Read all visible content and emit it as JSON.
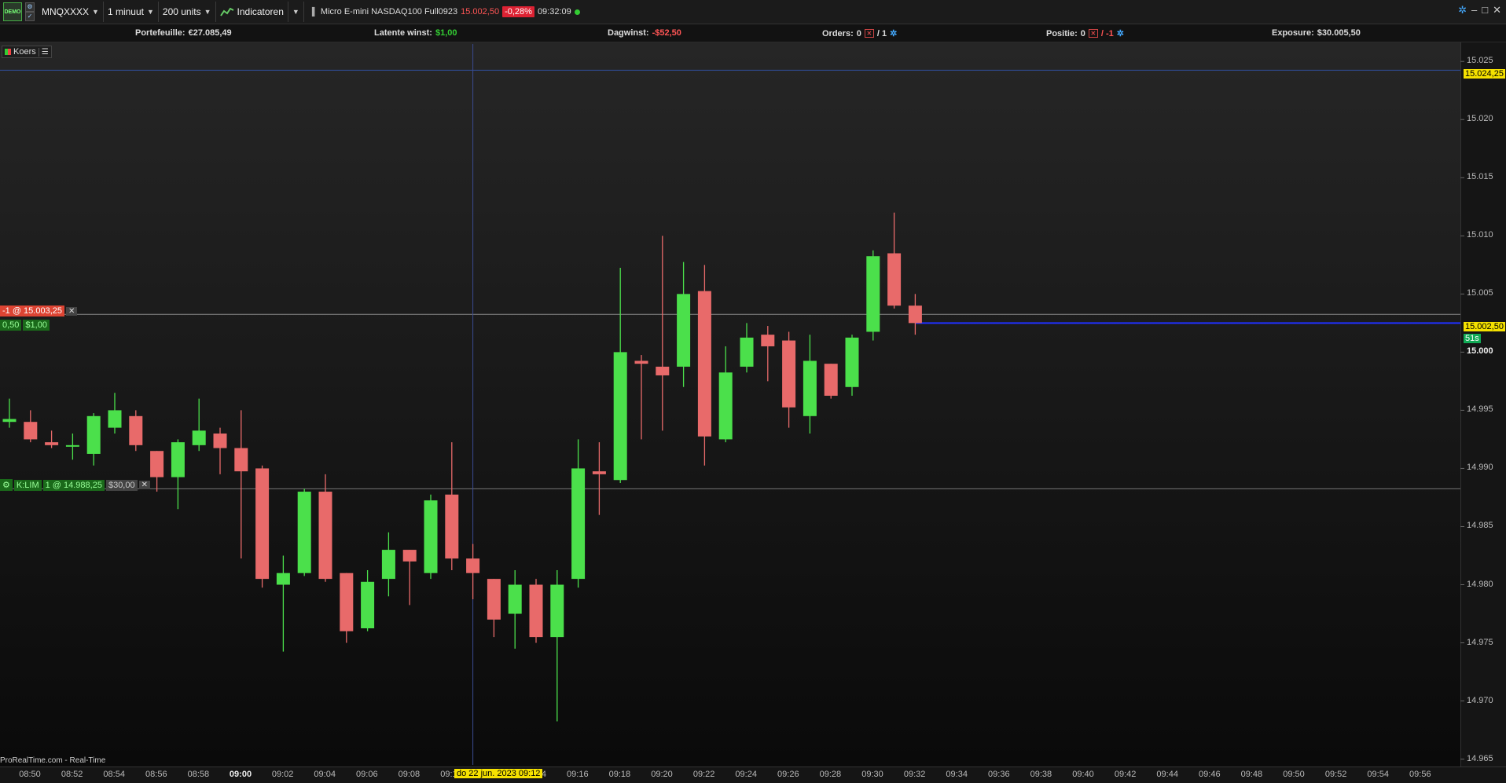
{
  "toolbar": {
    "logo": "DEMO",
    "symbol": "MNQXXXX",
    "timeframe": "1 minuut",
    "units": "200 units",
    "indicators": "Indicatoren",
    "instrument": "Micro E-mini NASDAQ100 Full0923",
    "last_price": "15.002,50",
    "change_pct": "-0,28%",
    "time": "09:32:09"
  },
  "infobar": {
    "portfolio_label": "Portefeuille:",
    "portfolio_value": "€27.085,49",
    "latent_label": "Latente winst:",
    "latent_value": "$1,00",
    "day_label": "Dagwinst:",
    "day_value": "-$52,50",
    "orders_label": "Orders:",
    "orders_value": "0",
    "orders_value2": "/ 1",
    "position_label": "Positie:",
    "position_value": "0",
    "position_value2": "/ -1",
    "exposure_label": "Exposure:",
    "exposure_value": "$30.005,50"
  },
  "legend": {
    "label": "Koers"
  },
  "position_tag": {
    "label": "-1 @ 15.003,25",
    "pl1": "0,50",
    "pl2": "$1,00"
  },
  "order_tag": {
    "label": "K:LIM",
    "detail": "1 @ 14.988,25",
    "value": "$30,00"
  },
  "y_tags": {
    "top": "15.024,25",
    "last": "15.002,50",
    "countdown": "51s"
  },
  "date_tag": "do 22 jun. 2023 09:12",
  "source": "ProRealTime.com - Real-Time",
  "colors": {
    "up": "#4be04b",
    "down": "#e86a6a",
    "accent": "#f5e100"
  },
  "chart_data": {
    "type": "candlestick",
    "y_ticks": [
      "15.025",
      "15.020",
      "15.015",
      "15.010",
      "15.005",
      "15.000",
      "14.995",
      "14.990",
      "14.985",
      "14.980",
      "14.975",
      "14.970",
      "14.965"
    ],
    "ylim": [
      14964.5,
      15026.5
    ],
    "x_ticks": [
      "08:50",
      "08:52",
      "08:54",
      "08:56",
      "08:58",
      "09:00",
      "09:02",
      "09:04",
      "09:06",
      "09:08",
      "09:10",
      "09:12",
      "09:14",
      "09:16",
      "09:18",
      "09:20",
      "09:22",
      "09:24",
      "09:26",
      "09:28",
      "09:30",
      "09:32",
      "09:34",
      "09:36",
      "09:38",
      "09:40",
      "09:42",
      "09:44",
      "09:46",
      "09:48",
      "09:50",
      "09:52",
      "09:54",
      "09:56"
    ],
    "candles": [
      {
        "t": "08:50",
        "o": 14994.0,
        "h": 14996.0,
        "l": 14993.5,
        "c": 14994.25
      },
      {
        "t": "08:51",
        "o": 14994.0,
        "h": 14995.0,
        "l": 14992.25,
        "c": 14992.5
      },
      {
        "t": "08:52",
        "o": 14992.25,
        "h": 14993.25,
        "l": 14991.75,
        "c": 14992.0
      },
      {
        "t": "08:53",
        "o": 14992.0,
        "h": 14993.0,
        "l": 14990.75,
        "c": 14992.0
      },
      {
        "t": "08:54",
        "o": 14991.25,
        "h": 14994.75,
        "l": 14990.25,
        "c": 14994.5
      },
      {
        "t": "08:55",
        "o": 14993.5,
        "h": 14996.5,
        "l": 14993.0,
        "c": 14995.0
      },
      {
        "t": "08:56",
        "o": 14994.5,
        "h": 14995.0,
        "l": 14991.5,
        "c": 14992.0
      },
      {
        "t": "08:57",
        "o": 14991.5,
        "h": 14991.5,
        "l": 14988.0,
        "c": 14989.25
      },
      {
        "t": "08:58",
        "o": 14989.25,
        "h": 14992.5,
        "l": 14986.5,
        "c": 14992.25
      },
      {
        "t": "08:59",
        "o": 14992.0,
        "h": 14996.0,
        "l": 14991.5,
        "c": 14993.25
      },
      {
        "t": "09:00",
        "o": 14993.0,
        "h": 14993.5,
        "l": 14989.5,
        "c": 14991.75
      },
      {
        "t": "09:01",
        "o": 14991.75,
        "h": 14995.0,
        "l": 14982.25,
        "c": 14989.75
      },
      {
        "t": "09:02",
        "o": 14990.0,
        "h": 14990.25,
        "l": 14979.75,
        "c": 14980.5
      },
      {
        "t": "09:03",
        "o": 14980.0,
        "h": 14982.5,
        "l": 14974.25,
        "c": 14981.0
      },
      {
        "t": "09:04",
        "o": 14981.0,
        "h": 14988.25,
        "l": 14980.75,
        "c": 14988.0
      },
      {
        "t": "09:05",
        "o": 14988.0,
        "h": 14989.5,
        "l": 14980.25,
        "c": 14980.5
      },
      {
        "t": "09:06",
        "o": 14981.0,
        "h": 14981.0,
        "l": 14975.0,
        "c": 14976.0
      },
      {
        "t": "09:07",
        "o": 14976.25,
        "h": 14981.25,
        "l": 14976.0,
        "c": 14980.25
      },
      {
        "t": "09:08",
        "o": 14980.5,
        "h": 14984.5,
        "l": 14979.0,
        "c": 14983.0
      },
      {
        "t": "09:09",
        "o": 14983.0,
        "h": 14983.0,
        "l": 14978.25,
        "c": 14982.0
      },
      {
        "t": "09:10",
        "o": 14981.0,
        "h": 14987.75,
        "l": 14980.5,
        "c": 14987.25
      },
      {
        "t": "09:11",
        "o": 14987.75,
        "h": 14992.25,
        "l": 14981.25,
        "c": 14982.25
      },
      {
        "t": "09:12",
        "o": 14982.25,
        "h": 14983.5,
        "l": 14978.75,
        "c": 14981.0
      },
      {
        "t": "09:13",
        "o": 14980.5,
        "h": 14980.5,
        "l": 14975.5,
        "c": 14977.0
      },
      {
        "t": "09:14",
        "o": 14977.5,
        "h": 14981.25,
        "l": 14974.5,
        "c": 14980.0
      },
      {
        "t": "09:15",
        "o": 14980.0,
        "h": 14980.5,
        "l": 14975.0,
        "c": 14975.5
      },
      {
        "t": "09:16",
        "o": 14975.5,
        "h": 14981.25,
        "l": 14968.25,
        "c": 14980.0
      },
      {
        "t": "09:17",
        "o": 14980.5,
        "h": 14992.5,
        "l": 14979.75,
        "c": 14990.0
      },
      {
        "t": "09:18",
        "o": 14989.75,
        "h": 14992.25,
        "l": 14986.0,
        "c": 14989.5
      },
      {
        "t": "09:19",
        "o": 14989.0,
        "h": 15007.25,
        "l": 14988.75,
        "c": 15000.0
      },
      {
        "t": "09:20",
        "o": 14999.25,
        "h": 14999.75,
        "l": 14992.5,
        "c": 14999.0
      },
      {
        "t": "09:21",
        "o": 14998.75,
        "h": 15010.0,
        "l": 14993.25,
        "c": 14998.0
      },
      {
        "t": "09:22",
        "o": 14998.75,
        "h": 15007.75,
        "l": 14997.0,
        "c": 15005.0
      },
      {
        "t": "09:23",
        "o": 15005.25,
        "h": 15007.5,
        "l": 14990.25,
        "c": 14992.75
      },
      {
        "t": "09:24",
        "o": 14992.5,
        "h": 15000.5,
        "l": 14992.25,
        "c": 14998.25
      },
      {
        "t": "09:25",
        "o": 14998.75,
        "h": 15002.5,
        "l": 14998.25,
        "c": 15001.25
      },
      {
        "t": "09:26",
        "o": 15001.5,
        "h": 15002.25,
        "l": 14997.5,
        "c": 15000.5
      },
      {
        "t": "09:27",
        "o": 15001.0,
        "h": 15001.75,
        "l": 14993.5,
        "c": 14995.25
      },
      {
        "t": "09:28",
        "o": 14994.5,
        "h": 15001.5,
        "l": 14993.0,
        "c": 14999.25
      },
      {
        "t": "09:29",
        "o": 14999.0,
        "h": 14999.0,
        "l": 14996.0,
        "c": 14996.25
      },
      {
        "t": "09:30",
        "o": 14997.0,
        "h": 15001.5,
        "l": 14996.25,
        "c": 15001.25
      },
      {
        "t": "09:31",
        "o": 15001.75,
        "h": 15008.75,
        "l": 15001.0,
        "c": 15008.25
      },
      {
        "t": "09:32",
        "o": 15008.5,
        "h": 15012.0,
        "l": 15003.75,
        "c": 15004.0
      },
      {
        "t": "09:33",
        "o": 15004.0,
        "h": 15005.0,
        "l": 15001.5,
        "c": 15002.5
      }
    ],
    "horizontal_lines": {
      "alert": 15024.25,
      "position": 15003.25,
      "last": 15002.5,
      "limit_order": 14988.25
    },
    "crosshair_time": "09:12"
  }
}
